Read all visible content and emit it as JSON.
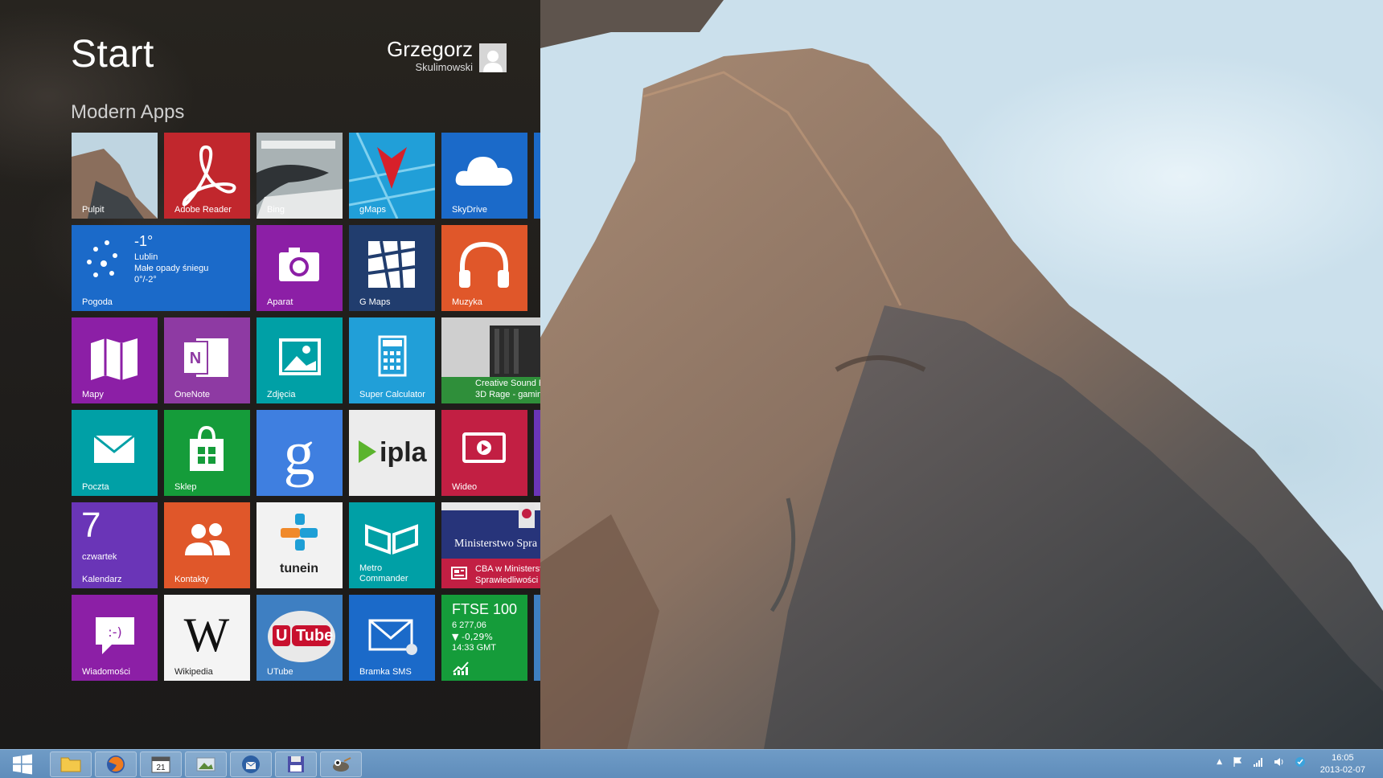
{
  "start": {
    "title": "Start",
    "user_first": "Grzegorz",
    "user_last": "Skulimowski",
    "group_title": "Modern Apps"
  },
  "tiles": {
    "pulpit": "Pulpit",
    "adobe_reader": "Adobe Reader",
    "bing": "Bing",
    "gmaps": "gMaps",
    "skydrive": "SkyDrive",
    "pogoda": "Pogoda",
    "weather_temp": "-1°",
    "weather_city": "Lublin",
    "weather_desc": "Małe opady śniegu",
    "weather_range": "0°/-2°",
    "aparat": "Aparat",
    "g_maps": "G Maps",
    "muzyka": "Muzyka",
    "mapy": "Mapy",
    "onenote": "OneNote",
    "zdjecia": "Zdjęcia",
    "super_calculator": "Super Calculator",
    "creative_line1": "Creative Sound B",
    "creative_line2": "3D Rage - gamin",
    "poczta": "Poczta",
    "sklep": "Sklep",
    "ipla": "ipla",
    "wideo": "Wideo",
    "calendar_day": "7",
    "calendar_weekday": "czwartek",
    "kalendarz": "Kalendarz",
    "kontakty": "Kontakty",
    "tunein": "tunein",
    "metro_commander": "Metro Commander",
    "news_banner": "Ministerstwo Spra",
    "news_line1": "CBA w Ministerst",
    "news_line2": "Sprawiedliwości",
    "wiadomosci": "Wiadomości",
    "wikipedia": "Wikipedia",
    "utube": "UTube",
    "utube_logo_u": "U",
    "utube_logo_tube": "Tube",
    "bramka_sms": "Bramka SMS",
    "ftse_title": "FTSE 100",
    "ftse_value": "6 277,06",
    "ftse_change": "▼ -0,29%",
    "ftse_time": "14:33 GMT"
  },
  "taskbar": {
    "clock_time": "16:05",
    "clock_date": "2013-02-07",
    "calendar_icon_text": "21"
  },
  "colors": {
    "red": "#c1272d",
    "blue": "#1b6ac9",
    "sky": "#219fd8",
    "purple": "#8c1fa6",
    "violet": "#6a35b7",
    "teal": "#00a0a6",
    "green": "#159c3a",
    "orange": "#e0572a",
    "navy": "#213d6e",
    "crimson": "#c21f43"
  }
}
